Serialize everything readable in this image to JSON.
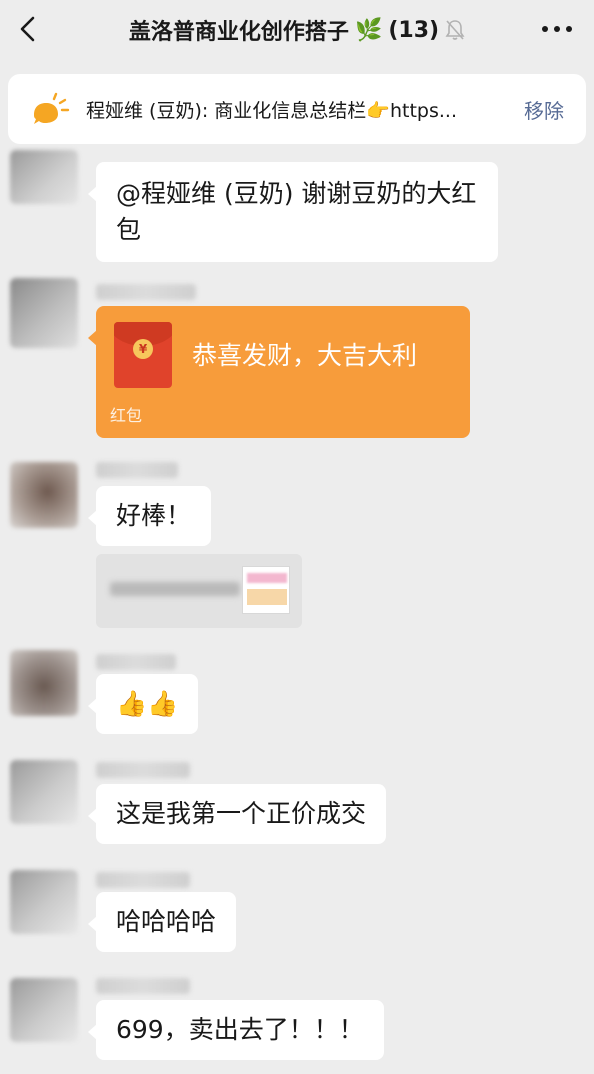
{
  "header": {
    "back_icon": "chevron-left-icon",
    "title": "盖洛普商业化创作搭子",
    "title_emoji": "🌿",
    "member_count": "(13)",
    "mute_icon": "bell-off-icon",
    "more_icon": "ellipsis-icon"
  },
  "pinned": {
    "icon": "sun-speech-bubble-icon",
    "text": "程娅维 (豆奶): 商业化信息总结栏👉https...",
    "remove_label": "移除"
  },
  "messages": [
    {
      "type": "text",
      "text": "@程娅维 (豆奶) 谢谢豆奶的大红包"
    },
    {
      "type": "red_packet",
      "title": "恭喜发财，大吉大利",
      "label": "红包"
    },
    {
      "type": "text",
      "text": "好棒！"
    },
    {
      "type": "text",
      "text": "👍👍"
    },
    {
      "type": "text",
      "text": "这是我第一个正价成交"
    },
    {
      "type": "text",
      "text": "哈哈哈哈"
    },
    {
      "type": "text",
      "text": "699，卖出去了！！！"
    }
  ],
  "colors": {
    "background": "#ededed",
    "bubble": "#ffffff",
    "red_packet": "#f79c3b",
    "link": "#576b95"
  }
}
